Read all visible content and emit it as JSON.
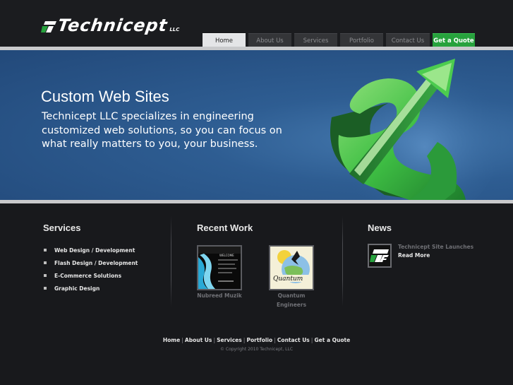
{
  "brand": {
    "name": "Technicept",
    "suffix": "LLC",
    "accent": "#27a23d"
  },
  "nav": {
    "items": [
      {
        "label": "Home"
      },
      {
        "label": "About Us"
      },
      {
        "label": "Services"
      },
      {
        "label": "Portfolio"
      },
      {
        "label": "Contact Us"
      },
      {
        "label": "Get a Quote"
      }
    ],
    "active": "Home"
  },
  "hero": {
    "title": "Custom Web Sites",
    "text": "Technicept LLC specializes in engineering customized web solutions, so you can focus on what really matters to you, your business."
  },
  "services": {
    "title": "Services",
    "items": [
      "Web Design / Development",
      "Flash Design / Development",
      "E-Commerce Solutions",
      "Graphic Design"
    ]
  },
  "recent_work": {
    "title": "Recent Work",
    "items": [
      {
        "caption": "Nubreed Muzik",
        "thumb_text": "WELCOME"
      },
      {
        "caption_line1": "Quantum",
        "caption_line2": "Engineers",
        "thumb_text": "Quantum"
      }
    ]
  },
  "news": {
    "title": "News",
    "headline": "Technicept Site Launches",
    "more": "Read More"
  },
  "footer": {
    "links": [
      "Home",
      "About Us",
      "Services",
      "Portfolio",
      "Contact Us",
      "Get a Quote"
    ],
    "copyright": "© Copyright 2010 Technicept, LLC"
  }
}
